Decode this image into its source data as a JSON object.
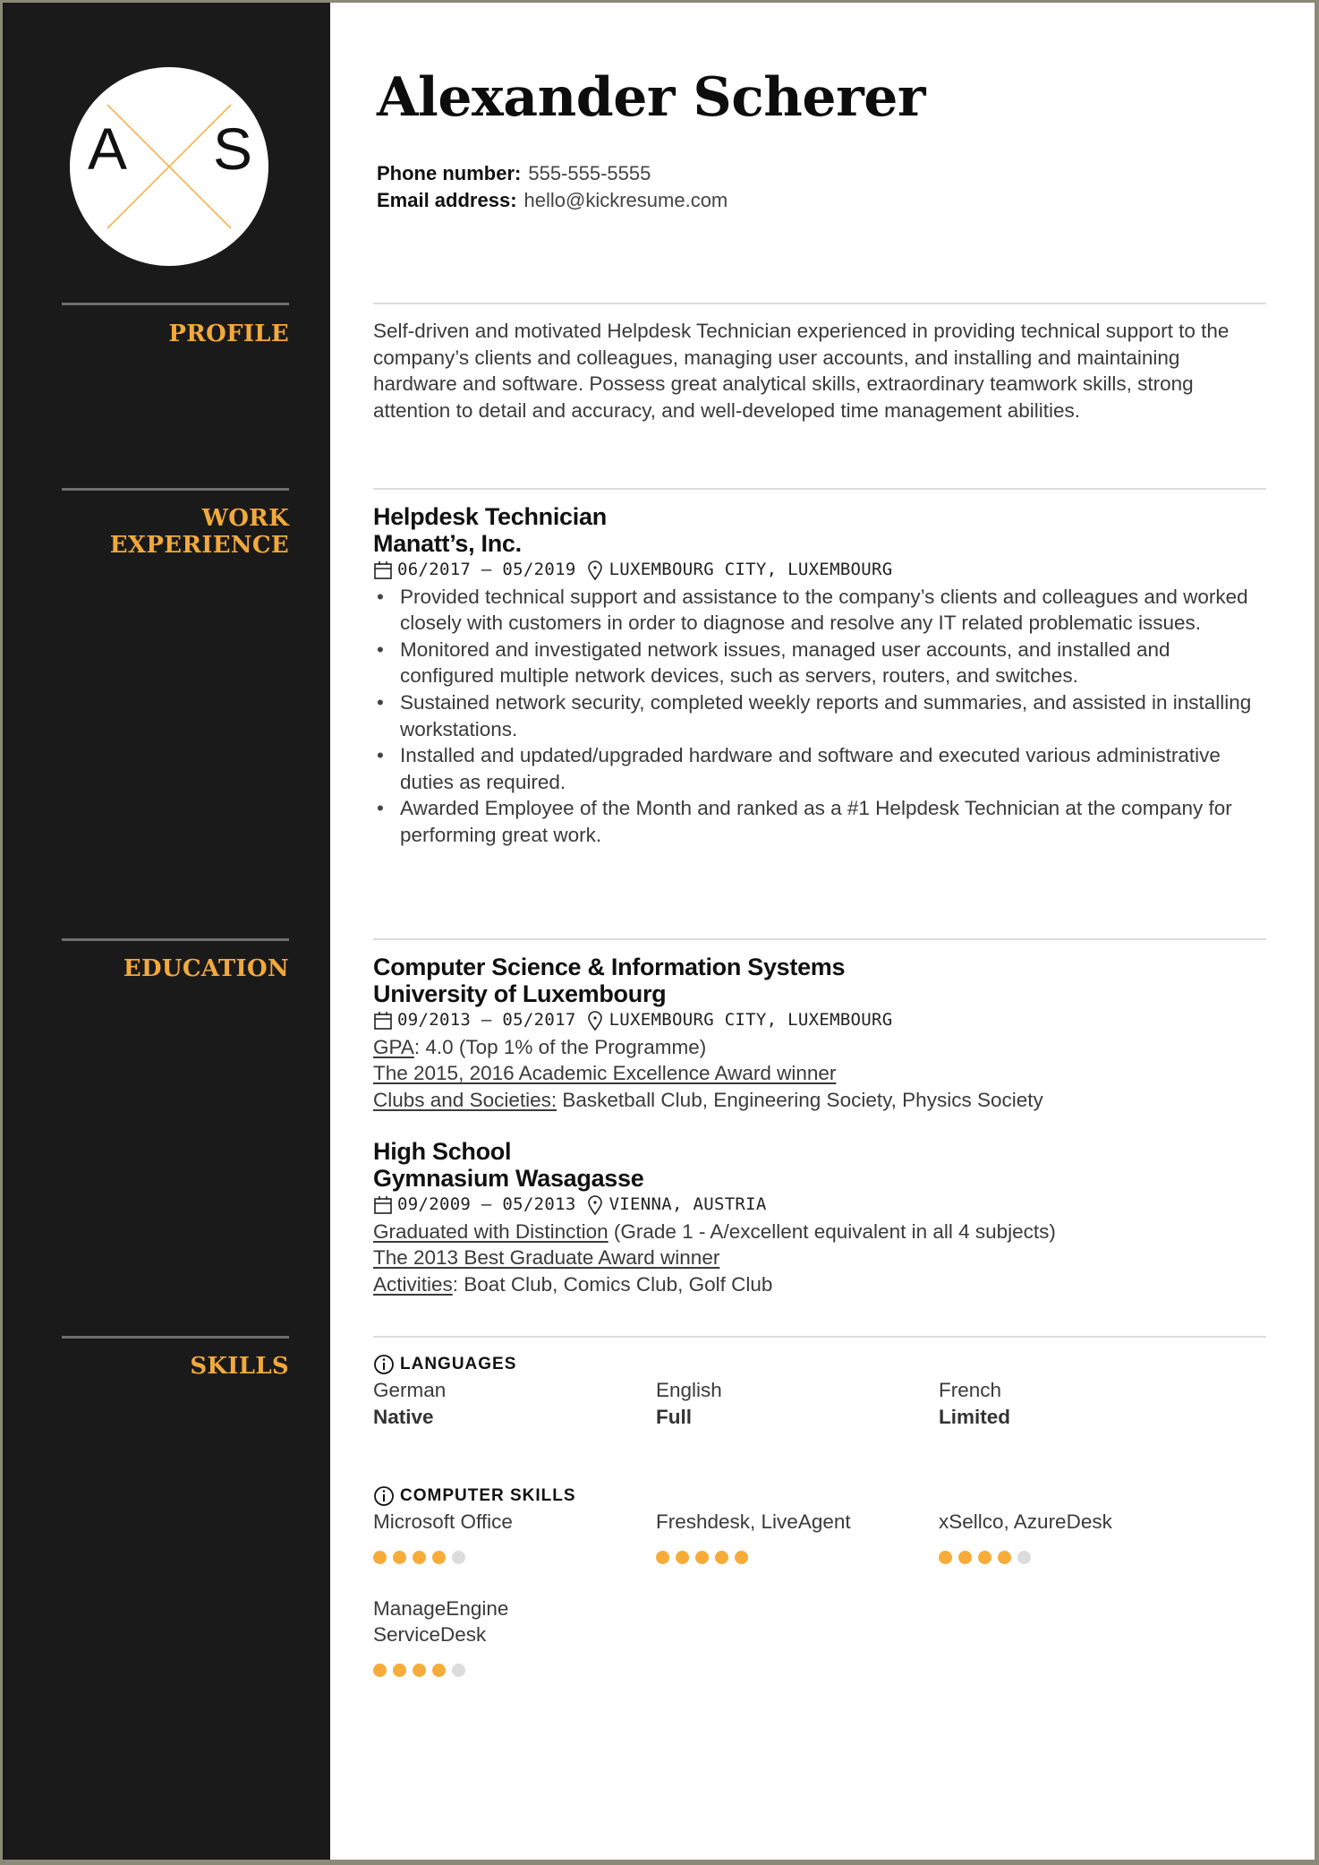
{
  "header": {
    "name": "Alexander Scherer",
    "initials": [
      "A",
      "S"
    ],
    "phone_label": "Phone number:",
    "phone": "555-555-5555",
    "email_label": "Email address:",
    "email": "hello@kickresume.com"
  },
  "colors": {
    "accent": "#f2a93b",
    "sidebar": "#1a1a1a",
    "dot_on": "#f7ac3a",
    "dot_off": "#dcdcdc"
  },
  "sections": {
    "profile": "PROFILE",
    "work_1": "WORK",
    "work_2": "EXPERIENCE",
    "education": "EDUCATION",
    "skills": "SKILLS"
  },
  "profile": {
    "text": "Self-driven and motivated Helpdesk Technician experienced in providing technical support to the company’s clients and colleagues, managing user accounts, and installing and maintaining hardware and software. Possess great analytical skills, extraordinary teamwork skills,  strong attention to detail and accuracy, and well-developed time management abilities."
  },
  "work": [
    {
      "title": "Helpdesk Technician",
      "company": "Manatt’s, Inc.",
      "dates": "06/2017 – 05/2019",
      "location": "LUXEMBOURG CITY, LUXEMBOURG",
      "bullets": [
        "Provided technical support and assistance to the company’s clients and colleagues and worked closely with customers in order to diagnose and resolve any IT related problematic issues.",
        "Monitored and investigated network issues, managed user accounts, and installed and configured multiple network devices, such as servers, routers, and switches.",
        "Sustained network security, completed weekly reports and summaries, and assisted in installing workstations.",
        "Installed and updated/upgraded hardware and software and executed various administrative duties as required.",
        "Awarded Employee of the Month and ranked as a #1 Helpdesk Technician at the company for performing great work."
      ]
    }
  ],
  "education": [
    {
      "degree": "Computer Science & Information Systems",
      "school": "University of Luxembourg",
      "dates": "09/2013 – 05/2017",
      "location": "LUXEMBOURG CITY, LUXEMBOURG",
      "lines": [
        {
          "link": "GPA",
          "rest": ": 4.0 (Top 1% of the Programme)"
        },
        {
          "link": "The 2015, 2016 Academic Excellence Award winner",
          "rest": ""
        },
        {
          "link": "Clubs and Societies:",
          "rest": " Basketball Club, Engineering Society, Physics Society"
        }
      ]
    },
    {
      "degree": "High School",
      "school": "Gymnasium Wasagasse",
      "dates": "09/2009 – 05/2013",
      "location": "VIENNA, AUSTRIA",
      "lines": [
        {
          "link": "Graduated with Distinction",
          "rest": " (Grade 1 - A/excellent equivalent in all 4 subjects)"
        },
        {
          "link": "The 2013 Best Graduate Award winner",
          "rest": ""
        },
        {
          "link": "Activities",
          "rest": ": Boat Club, Comics Club, Golf Club"
        }
      ]
    }
  ],
  "skills": {
    "languages_title": "LANGUAGES",
    "languages": [
      {
        "name": "German",
        "level": "Native"
      },
      {
        "name": "English",
        "level": "Full"
      },
      {
        "name": "French",
        "level": "Limited"
      }
    ],
    "computer_title": "COMPUTER SKILLS",
    "computer": [
      {
        "name": "Microsoft Office",
        "rating": 4,
        "max": 5
      },
      {
        "name": "Freshdesk, LiveAgent",
        "rating": 5,
        "max": 5
      },
      {
        "name": "xSellco, AzureDesk",
        "rating": 4,
        "max": 5
      },
      {
        "name": "ManageEngine ServiceDesk",
        "name_lines": [
          "ManageEngine",
          "ServiceDesk"
        ],
        "rating": 4,
        "max": 5
      }
    ]
  }
}
